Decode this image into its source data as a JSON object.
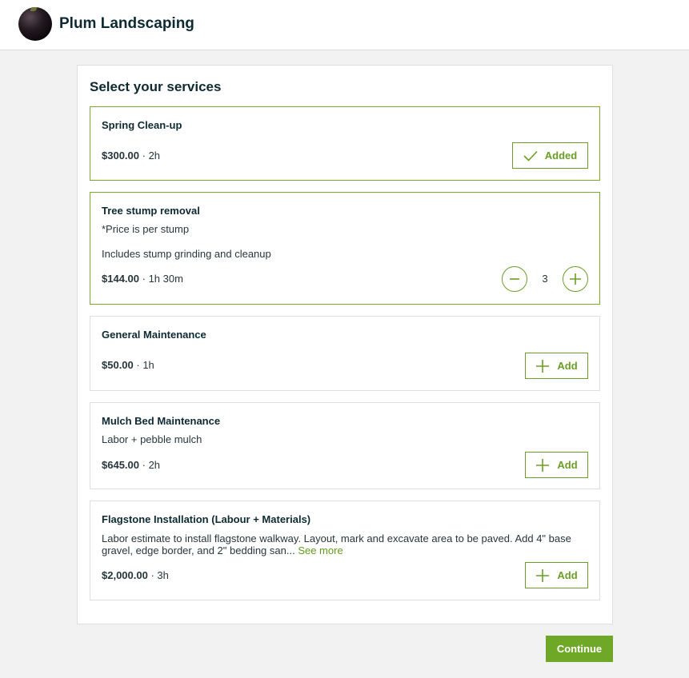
{
  "header": {
    "brand": "Plum Landscaping",
    "logo_icon": "plum-logo-icon"
  },
  "panel": {
    "title": "Select your services"
  },
  "services": [
    {
      "title": "Spring Clean-up",
      "price": "$300.00",
      "duration": "· 2h",
      "state": "added",
      "button_label": "Added"
    },
    {
      "title": "Tree stump removal",
      "desc1": "*Price is per stump",
      "desc2": "Includes stump grinding and cleanup",
      "price": "$144.00",
      "duration": "· 1h 30m",
      "state": "quantity",
      "quantity": "3"
    },
    {
      "title": "General Maintenance",
      "price": "$50.00",
      "duration": "· 1h",
      "state": "add",
      "button_label": "Add"
    },
    {
      "title": "Mulch Bed Maintenance",
      "desc1": "Labor + pebble mulch",
      "price": "$645.00",
      "duration": "· 2h",
      "state": "add",
      "button_label": "Add"
    },
    {
      "title": "Flagstone Installation (Labour + Materials)",
      "desc1": "Labor estimate to install flagstone walkway. Layout, mark and excavate area to be paved. Add 4\" base gravel, edge border, and 2\" bedding san...",
      "see_more": "See more",
      "price": "$2,000.00",
      "duration": "· 3h",
      "state": "add",
      "button_label": "Add"
    }
  ],
  "footer": {
    "continue_label": "Continue"
  },
  "colors": {
    "accent": "#6fa827",
    "text": "#0d2a33",
    "background": "#f2f2f2"
  }
}
